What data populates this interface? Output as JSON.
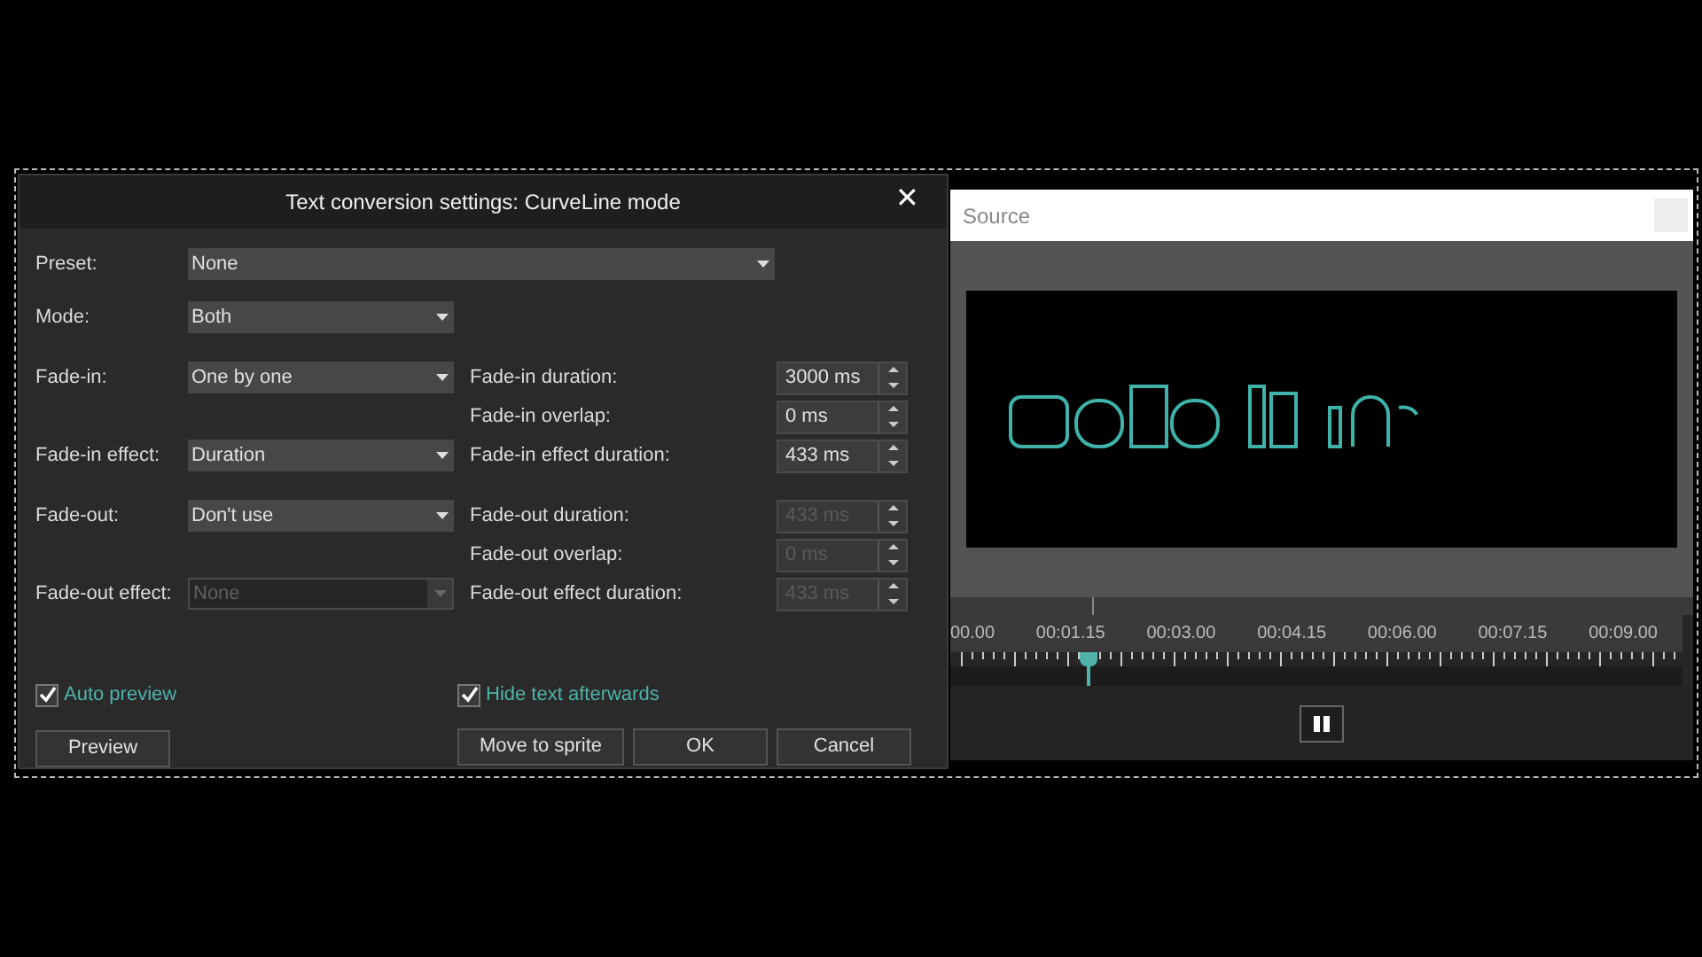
{
  "dialog": {
    "title": "Text conversion settings: CurveLine mode",
    "close": "✕",
    "preset": {
      "label": "Preset:",
      "value": "None",
      "disabled": false
    },
    "mode": {
      "label": "Mode:",
      "value": "Both",
      "disabled": false
    },
    "groups": [
      [
        {
          "left": {
            "label": "Fade-in:",
            "value": "One by one",
            "disabled": false
          },
          "right": {
            "label": "Fade-in duration:",
            "value": "3000 ms",
            "disabled": false
          }
        },
        {
          "right": {
            "label": "Fade-in overlap:",
            "value": "0 ms",
            "disabled": false
          }
        },
        {
          "left": {
            "label": "Fade-in effect:",
            "value": "Duration",
            "disabled": false
          },
          "right": {
            "label": "Fade-in effect duration:",
            "value": "433 ms",
            "disabled": false
          }
        }
      ],
      [
        {
          "left": {
            "label": "Fade-out:",
            "value": "Don't use",
            "disabled": false
          },
          "right": {
            "label": "Fade-out duration:",
            "value": "433 ms",
            "disabled": true
          }
        },
        {
          "right": {
            "label": "Fade-out overlap:",
            "value": "0 ms",
            "disabled": true
          }
        },
        {
          "left": {
            "label": "Fade-out effect:",
            "value": "None",
            "disabled": true
          },
          "right": {
            "label": "Fade-out effect duration:",
            "value": "433 ms",
            "disabled": true
          }
        }
      ]
    ],
    "checkboxes": [
      {
        "label": "Auto preview",
        "checked": true
      },
      {
        "label": "Hide text afterwards",
        "checked": true
      }
    ],
    "preview_button": "Preview",
    "buttons": [
      "Move to sprite",
      "OK",
      "Cancel"
    ]
  },
  "source": {
    "title": "Source",
    "timeline": {
      "labels": [
        "00.00",
        "00:01.15",
        "00:03.00",
        "00:04.15",
        "00:06.00",
        "00:07.15",
        "00:09.00"
      ],
      "playhead": {
        "level": 0.19
      }
    }
  }
}
